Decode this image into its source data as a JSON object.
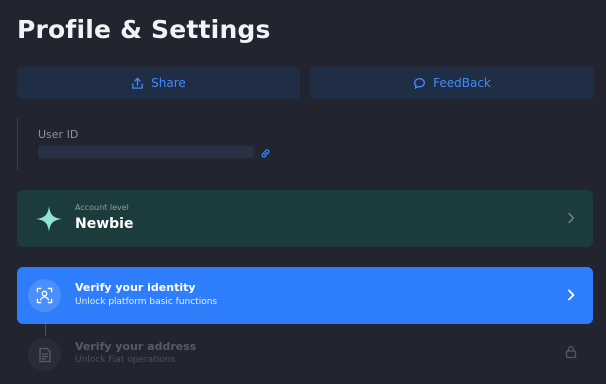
{
  "page": {
    "title": "Profile & Settings"
  },
  "actions": {
    "share_label": "Share",
    "share_icon": "share-icon",
    "feedback_label": "FeedBack",
    "feedback_icon": "chat-bubble-icon"
  },
  "user": {
    "id_label": "User ID",
    "id_value": ""
  },
  "account_level": {
    "caption": "Account level",
    "value": "Newbie",
    "icon": "sparkle-star-icon"
  },
  "verification_steps": [
    {
      "title": "Verify your identity",
      "subtitle": "Unlock platform basic functions",
      "state": "active"
    },
    {
      "title": "Verify your address",
      "subtitle": "Unlock Fiat operations",
      "state": "locked"
    }
  ],
  "colors": {
    "background": "#22252f",
    "accent": "#2e7dfa",
    "link": "#3f8cff",
    "level_card": "#1b3b3c"
  }
}
